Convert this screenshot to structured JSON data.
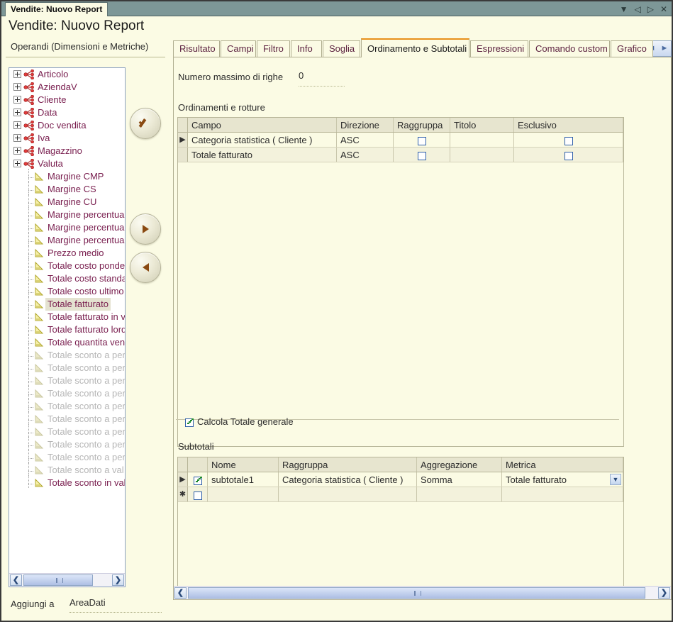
{
  "window": {
    "doc_tab": "Vendite: Nuovo Report",
    "page_title": "Vendite: Nuovo Report",
    "controls": [
      {
        "name": "dropdown-icon",
        "glyph": "▼"
      },
      {
        "name": "prev-icon",
        "glyph": "◁"
      },
      {
        "name": "next-icon",
        "glyph": "▷"
      },
      {
        "name": "close-icon",
        "glyph": "✕"
      }
    ]
  },
  "left": {
    "operands_label": "Operandi (Dimensioni e Metriche)",
    "add_to_label": "Aggiungi a",
    "add_to_value": "AreaDati",
    "tree": [
      {
        "label": "Articolo",
        "kind": "dimension",
        "expandable": true,
        "disabled": false,
        "selected": false
      },
      {
        "label": "AziendaV",
        "kind": "dimension",
        "expandable": true,
        "disabled": false,
        "selected": false
      },
      {
        "label": "Cliente",
        "kind": "dimension",
        "expandable": true,
        "disabled": false,
        "selected": false
      },
      {
        "label": "Data",
        "kind": "dimension",
        "expandable": true,
        "disabled": false,
        "selected": false
      },
      {
        "label": "Doc vendita",
        "kind": "dimension",
        "expandable": true,
        "disabled": false,
        "selected": false
      },
      {
        "label": "Iva",
        "kind": "dimension",
        "expandable": true,
        "disabled": false,
        "selected": false
      },
      {
        "label": "Magazzino",
        "kind": "dimension",
        "expandable": true,
        "disabled": false,
        "selected": false
      },
      {
        "label": "Valuta",
        "kind": "dimension",
        "expandable": true,
        "disabled": false,
        "selected": false
      },
      {
        "label": "Margine CMP",
        "kind": "metric",
        "expandable": false,
        "disabled": false,
        "selected": false
      },
      {
        "label": "Margine CS",
        "kind": "metric",
        "expandable": false,
        "disabled": false,
        "selected": false
      },
      {
        "label": "Margine CU",
        "kind": "metric",
        "expandable": false,
        "disabled": false,
        "selected": false
      },
      {
        "label": "Margine percentual",
        "kind": "metric",
        "expandable": false,
        "disabled": false,
        "selected": false
      },
      {
        "label": "Margine percentual",
        "kind": "metric",
        "expandable": false,
        "disabled": false,
        "selected": false
      },
      {
        "label": "Margine percentual",
        "kind": "metric",
        "expandable": false,
        "disabled": false,
        "selected": false
      },
      {
        "label": "Prezzo medio",
        "kind": "metric",
        "expandable": false,
        "disabled": false,
        "selected": false
      },
      {
        "label": "Totale costo ponde",
        "kind": "metric",
        "expandable": false,
        "disabled": false,
        "selected": false
      },
      {
        "label": "Totale costo standa",
        "kind": "metric",
        "expandable": false,
        "disabled": false,
        "selected": false
      },
      {
        "label": "Totale costo ultimo",
        "kind": "metric",
        "expandable": false,
        "disabled": false,
        "selected": false
      },
      {
        "label": "Totale fatturato",
        "kind": "metric",
        "expandable": false,
        "disabled": false,
        "selected": true
      },
      {
        "label": "Totale fatturato in va",
        "kind": "metric",
        "expandable": false,
        "disabled": false,
        "selected": false
      },
      {
        "label": "Totale fatturato lord",
        "kind": "metric",
        "expandable": false,
        "disabled": false,
        "selected": false
      },
      {
        "label": "Totale quantita ven",
        "kind": "metric",
        "expandable": false,
        "disabled": false,
        "selected": false
      },
      {
        "label": "Totale sconto a per",
        "kind": "metric",
        "expandable": false,
        "disabled": true,
        "selected": false
      },
      {
        "label": "Totale sconto a per",
        "kind": "metric",
        "expandable": false,
        "disabled": true,
        "selected": false
      },
      {
        "label": "Totale sconto a per",
        "kind": "metric",
        "expandable": false,
        "disabled": true,
        "selected": false
      },
      {
        "label": "Totale sconto a per",
        "kind": "metric",
        "expandable": false,
        "disabled": true,
        "selected": false
      },
      {
        "label": "Totale sconto a per",
        "kind": "metric",
        "expandable": false,
        "disabled": true,
        "selected": false
      },
      {
        "label": "Totale sconto a per",
        "kind": "metric",
        "expandable": false,
        "disabled": true,
        "selected": false
      },
      {
        "label": "Totale sconto a per",
        "kind": "metric",
        "expandable": false,
        "disabled": true,
        "selected": false
      },
      {
        "label": "Totale sconto a per",
        "kind": "metric",
        "expandable": false,
        "disabled": true,
        "selected": false
      },
      {
        "label": "Totale sconto a per",
        "kind": "metric",
        "expandable": false,
        "disabled": true,
        "selected": false
      },
      {
        "label": "Totale sconto a val",
        "kind": "metric",
        "expandable": false,
        "disabled": true,
        "selected": false
      },
      {
        "label": "Totale sconto in val",
        "kind": "metric",
        "expandable": false,
        "disabled": false,
        "selected": false
      }
    ]
  },
  "center_buttons": [
    {
      "name": "confirm-button",
      "icon": "check-icon"
    },
    {
      "name": "add-operand-button",
      "icon": "arrow-right-icon"
    },
    {
      "name": "remove-operand-button",
      "icon": "arrow-left-icon"
    }
  ],
  "right_buttons": [
    {
      "name": "move-up-button",
      "icon": "arrow-up-icon"
    },
    {
      "name": "move-down-button",
      "icon": "arrow-down-icon"
    }
  ],
  "tabs": {
    "items": [
      {
        "label": "Risultato",
        "active": false
      },
      {
        "label": "Campi",
        "active": false
      },
      {
        "label": "Filtro",
        "active": false
      },
      {
        "label": "Info",
        "active": false
      },
      {
        "label": "Soglia",
        "active": false
      },
      {
        "label": "Ordinamento e Subtotali",
        "active": true
      },
      {
        "label": "Espressioni",
        "active": false
      },
      {
        "label": "Comando custom",
        "active": false
      },
      {
        "label": "Grafico",
        "active": false
      }
    ],
    "nav_prev": "◄",
    "nav_next": "►",
    "active_accent": "#e8901a"
  },
  "pane": {
    "max_rows_label": "Numero massimo di righe",
    "max_rows_value": "0",
    "sorting_label": "Ordinamenti e rotture",
    "calc_total_label": "Calcola Totale generale",
    "calc_total_checked": true,
    "subtotals_label": "Subtotali",
    "sort_grid": {
      "columns": [
        "Campo",
        "Direzione",
        "Raggruppa",
        "Titolo",
        "Esclusivo"
      ],
      "rows": [
        {
          "marker": "▶",
          "campo": "Categoria statistica ( Cliente )",
          "direzione": "ASC",
          "raggruppa": false,
          "titolo": "",
          "esclusivo": false
        },
        {
          "marker": "",
          "campo": "Totale fatturato",
          "direzione": "ASC",
          "raggruppa": false,
          "titolo": "",
          "esclusivo": false
        }
      ]
    },
    "subtotal_grid": {
      "columns": [
        "",
        "Nome",
        "Raggruppa",
        "Aggregazione",
        "Metrica"
      ],
      "rows": [
        {
          "marker": "▶",
          "enabled": true,
          "nome": "subtotale1",
          "raggruppa": "Categoria statistica ( Cliente )",
          "aggregazione": "Somma",
          "metrica": "Totale fatturato",
          "has_dropdown": true
        },
        {
          "marker": "✱",
          "enabled": false,
          "nome": "",
          "raggruppa": "",
          "aggregazione": "",
          "metrica": "",
          "has_dropdown": false
        }
      ]
    }
  },
  "scrollbars": {
    "left_arrow": "❮",
    "right_arrow": "❯"
  }
}
